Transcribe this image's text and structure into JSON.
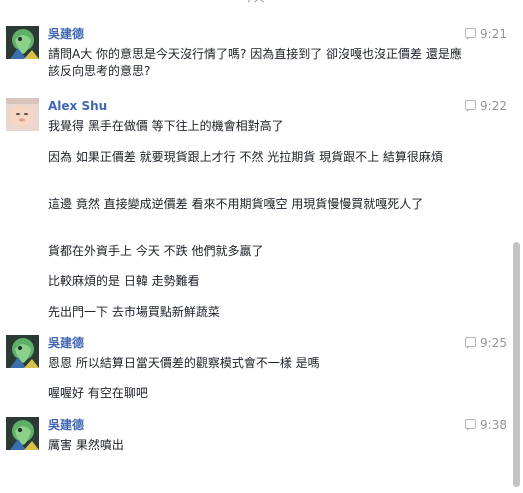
{
  "date_divider": "今天",
  "messages": [
    {
      "sender": "吳建德",
      "avatar": "avatar-wu",
      "time": "9:21",
      "lines": [
        "請問A大 你的意思是今天沒行情了嗎? 因為直接到了 卻沒嘎也沒正價差 還是應該反向思考的意思?"
      ]
    },
    {
      "sender": "Alex Shu",
      "avatar": "avatar-alex",
      "time": "9:22",
      "lines": [
        "我覺得 黑手在做價 等下往上的機會相對高了",
        "因為 如果正價差 就要現貨跟上才行 不然 光拉期貨 現貨跟不上 結算很麻煩",
        "這邊 竟然 直接變成逆價差 看來不用期貨嘎空 用現貨慢慢買就嘎死人了",
        "貨都在外資手上 今天 不跌 他們就多贏了",
        "比較麻煩的是 日韓 走勢難看",
        "先出門一下 去市場買點新鮮蔬菜"
      ]
    },
    {
      "sender": "吳建德",
      "avatar": "avatar-wu",
      "time": "9:25",
      "lines": [
        "恩恩 所以結算日當天價差的觀察模式會不一樣 是嗎",
        "喔喔好 有空在聊吧"
      ]
    },
    {
      "sender": "吳建德",
      "avatar": "avatar-wu",
      "time": "9:38",
      "lines": [
        "厲害 果然噴出"
      ]
    }
  ]
}
